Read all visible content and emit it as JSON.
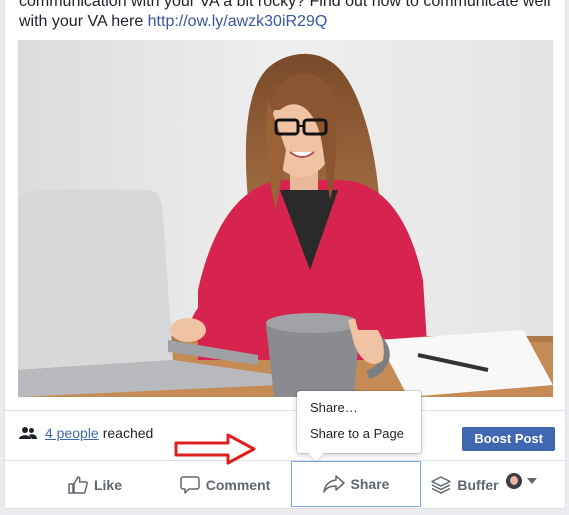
{
  "post": {
    "text_line1": "communication with your VA a bit rocky? Find out how to communicate well",
    "text_line2_prefix": "with your VA here ",
    "link": "http://ow.ly/awzk30iR29Q"
  },
  "reach": {
    "count_label": "4 people",
    "suffix": "reached"
  },
  "boost_button": "Boost Post",
  "actions": {
    "like": "Like",
    "comment": "Comment",
    "share": "Share",
    "buffer": "Buffer"
  },
  "share_menu": {
    "items": [
      "Share…",
      "Share to a Page"
    ]
  },
  "colors": {
    "brand_blue": "#4267b2",
    "link": "#365899",
    "arrow": "#e02020"
  },
  "icons": {
    "reach": "people-icon",
    "like": "thumbs-up-icon",
    "comment": "speech-bubble-icon",
    "share": "share-arrow-icon",
    "buffer": "layers-stack-icon",
    "annotation": "red-outline-arrow-icon"
  }
}
